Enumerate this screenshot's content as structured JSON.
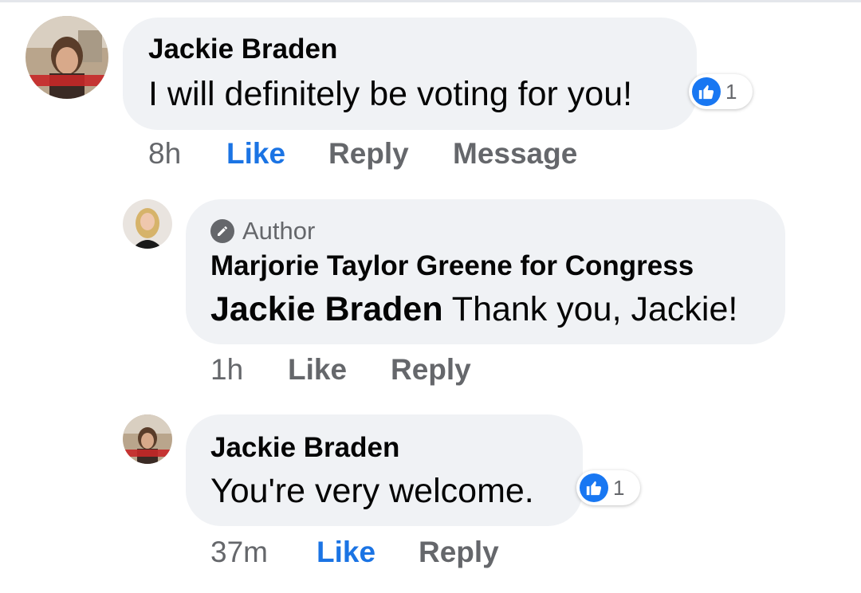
{
  "comments": [
    {
      "author": "Jackie Braden",
      "text": "I will definitely be voting for you!",
      "reaction_count": "1",
      "time": "8h",
      "like_label": "Like",
      "reply_label": "Reply",
      "message_label": "Message",
      "liked": true
    },
    {
      "badge": "Author",
      "author": "Marjorie Taylor Greene for Congress",
      "mention": "Jackie Braden",
      "text": "Thank you, Jackie!",
      "time": "1h",
      "like_label": "Like",
      "reply_label": "Reply",
      "liked": false
    },
    {
      "author": "Jackie Braden",
      "text": "You're very welcome.",
      "reaction_count": "1",
      "time": "37m",
      "like_label": "Like",
      "reply_label": "Reply",
      "liked": true
    }
  ],
  "colors": {
    "bubble": "#f0f2f5",
    "like_blue": "#1b74e4",
    "meta_gray": "#65676b"
  },
  "icons": [
    "thumbs-up-icon",
    "pencil-icon"
  ]
}
